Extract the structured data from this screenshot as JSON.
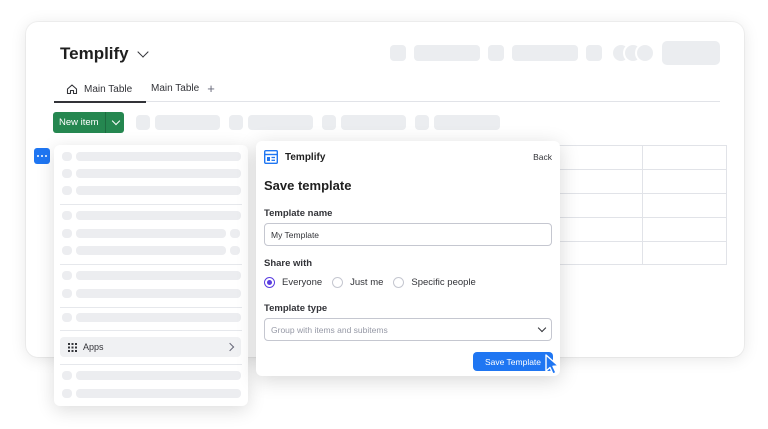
{
  "board": {
    "title": "Templify",
    "tabs": [
      {
        "label": "Main Table",
        "active": true
      },
      {
        "label": "Main Table",
        "active": false
      }
    ],
    "add_tab": "+",
    "new_item_label": "New item"
  },
  "menu": {
    "apps_label": "Apps"
  },
  "panel": {
    "app_name": "Templify",
    "back_label": "Back",
    "title": "Save template",
    "template_name_label": "Template name",
    "template_name_value": "My Template",
    "share_with_label": "Share with",
    "share_options": [
      {
        "label": "Everyone",
        "selected": true
      },
      {
        "label": "Just me",
        "selected": false
      },
      {
        "label": "Specific people",
        "selected": false
      }
    ],
    "template_type_label": "Template type",
    "template_type_placeholder": "Group with items and subitems",
    "save_button": "Save Template"
  },
  "colors": {
    "primary": "#1f76f2",
    "green": "#258750",
    "radio_selected": "#5a3ee0",
    "skeleton": "#ebedf0"
  }
}
